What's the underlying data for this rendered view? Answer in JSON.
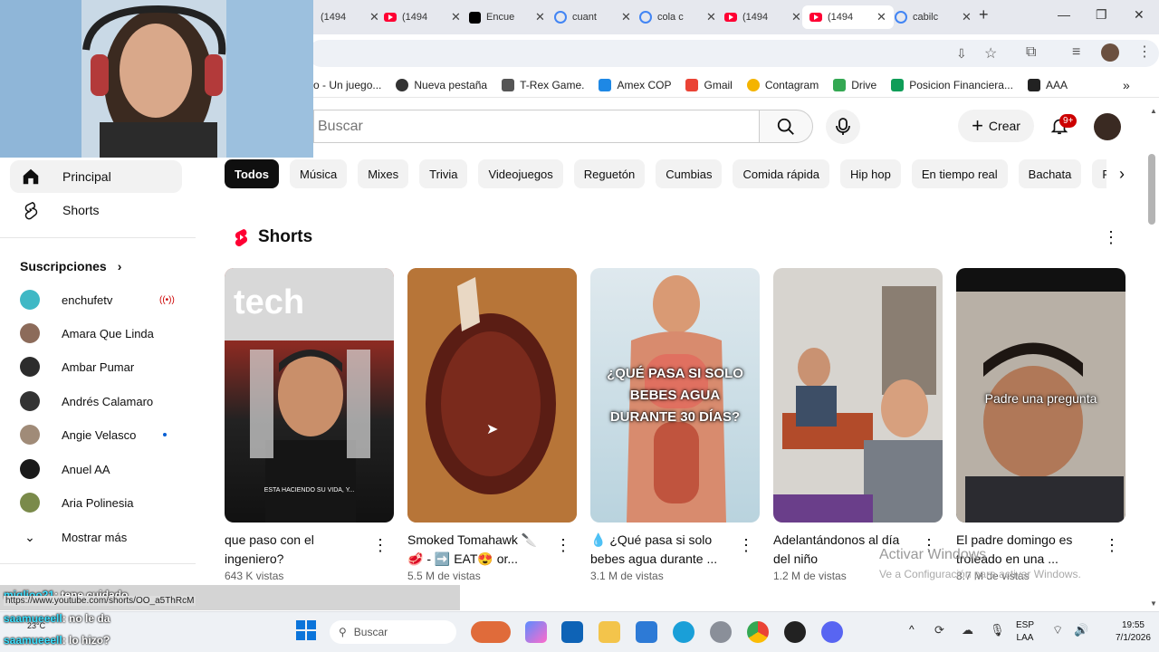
{
  "browser": {
    "tabs": [
      {
        "label": "(1494",
        "icon": "youtube-icon"
      },
      {
        "label": "(1494",
        "icon": "youtube-icon"
      },
      {
        "label": "Encue",
        "icon": "tiktok-icon"
      },
      {
        "label": "cuant",
        "icon": "google-icon"
      },
      {
        "label": "cola c",
        "icon": "google-icon"
      },
      {
        "label": "(1494",
        "icon": "youtube-icon"
      },
      {
        "label": "(1494",
        "icon": "youtube-icon",
        "active": true
      },
      {
        "label": "cabilc",
        "icon": "google-icon"
      }
    ],
    "bookmarks": [
      "o - Un juego...",
      "Nueva pestaña",
      "T-Rex Game.",
      "Amex COP",
      "Gmail",
      "Contagram",
      "Drive",
      "Posicion Financiera...",
      "AAA"
    ]
  },
  "header": {
    "search_placeholder": "Buscar",
    "create_label": "Crear",
    "notif_badge": "9+"
  },
  "sidebar": {
    "main": [
      {
        "label": "Principal",
        "icon": "home-icon"
      },
      {
        "label": "Shorts",
        "icon": "shorts-icon"
      }
    ],
    "subs_title": "Suscripciones",
    "subs": [
      {
        "label": "enchufetv",
        "indicator": "live",
        "color": "#3fb8c5"
      },
      {
        "label": "Amara Que Linda",
        "color": "#8c6b5a"
      },
      {
        "label": "Ambar Pumar",
        "color": "#2c2c2c"
      },
      {
        "label": "Andrés Calamaro",
        "color": "#333333"
      },
      {
        "label": "Angie Velasco",
        "indicator": "dot",
        "color": "#a08b78"
      },
      {
        "label": "Anuel AA",
        "color": "#1a1a1a"
      },
      {
        "label": "Aria Polinesia",
        "color": "#7a8a4a"
      }
    ],
    "show_more": "Mostrar más"
  },
  "chips": [
    "Todos",
    "Música",
    "Mixes",
    "Trivia",
    "Videojuegos",
    "Reguetón",
    "Cumbias",
    "Comida rápida",
    "Hip hop",
    "En tiempo real",
    "Bachata",
    "F"
  ],
  "shorts_title": "Shorts",
  "shorts": [
    {
      "title": "que paso con el ingeniero?",
      "views": "643 K vistas",
      "overlay": "ESTA HACIENDO SU VIDA, Y..."
    },
    {
      "title": "Smoked Tomahawk 🔪🥩 - ➡️ EAT😍 or...",
      "views": "5.5 M de vistas",
      "overlay": ""
    },
    {
      "title": "💧 ¿Qué pasa si solo bebes agua durante ...",
      "views": "3.1 M de vistas",
      "overlay": "¿QUÉ PASA SI SOLO BEBES AGUA DURANTE 30 DÍAS?"
    },
    {
      "title": "Adelantándonos al día del niño",
      "views": "1.2 M de vistas",
      "overlay": ""
    },
    {
      "title": "El padre domingo es troleado en una ...",
      "views": "8.7 M de vistas",
      "overlay": "Padre una pregunta"
    }
  ],
  "chat": [
    {
      "user": "miglioo21",
      "msg": ": tene cuidado"
    },
    {
      "user": "",
      "msg": "https://www.youtube.com/shorts/OO_a5ThRcM"
    },
    {
      "user": "saamueeell",
      "msg": ": no le da"
    },
    {
      "user": "saamueeell",
      "msg": ": lo hizo?"
    }
  ],
  "watermark": {
    "line1": "Activar Windows",
    "line2": "Ve a Configuración para activar Windows."
  },
  "taskbar": {
    "search": "Buscar",
    "lang": "ESP",
    "layout": "LAA",
    "time": "19:55",
    "date": "7/1/2026",
    "weather": "23°C"
  }
}
